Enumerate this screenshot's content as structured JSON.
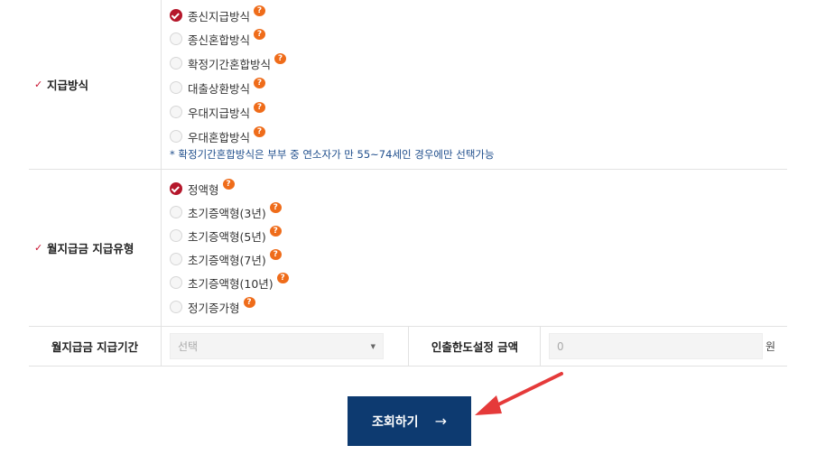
{
  "payment_method": {
    "label": "지급방식",
    "options": [
      {
        "label": "종신지급방식",
        "selected": true
      },
      {
        "label": "종신혼합방식",
        "selected": false
      },
      {
        "label": "확정기간혼합방식",
        "selected": false
      },
      {
        "label": "대출상환방식",
        "selected": false
      },
      {
        "label": "우대지급방식",
        "selected": false
      },
      {
        "label": "우대혼합방식",
        "selected": false
      }
    ],
    "note": "* 확정기간혼합방식은 부부 중 연소자가 만 55~74세인 경우에만 선택가능"
  },
  "monthly_type": {
    "label": "월지급금 지급유형",
    "options": [
      {
        "label": "정액형",
        "selected": true
      },
      {
        "label": "초기증액형(3년)",
        "selected": false
      },
      {
        "label": "초기증액형(5년)",
        "selected": false
      },
      {
        "label": "초기증액형(7년)",
        "selected": false
      },
      {
        "label": "초기증액형(10년)",
        "selected": false
      },
      {
        "label": "정기증가형",
        "selected": false
      }
    ]
  },
  "period": {
    "label": "월지급금 지급기간",
    "select_value": "선택",
    "limit_label": "인출한도설정 금액",
    "limit_value": "0",
    "unit": "원"
  },
  "submit": {
    "label": "조회하기",
    "arrow": "→"
  },
  "icons": {
    "help": "?",
    "check": "✓"
  },
  "colors": {
    "selected": "#b5172b",
    "help": "#ef6c1a",
    "button": "#0d3a70",
    "note": "#1f4e8c",
    "pointer": "#e53a3a"
  }
}
